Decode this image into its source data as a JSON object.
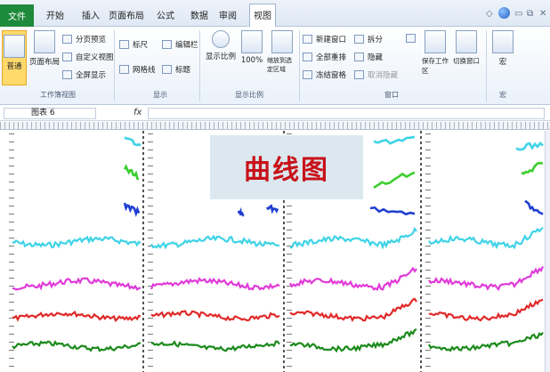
{
  "tabs": {
    "file": "文件",
    "items": [
      "开始",
      "插入",
      "页面布局",
      "公式",
      "数据",
      "审阅",
      "视图"
    ],
    "active_index": 6
  },
  "ribbon": {
    "workbook_views": {
      "label": "工作簿视图",
      "normal": "普通",
      "page_layout": "页面布局",
      "page_break": "分页预览",
      "custom": "自定义视图",
      "fullscreen": "全屏显示"
    },
    "show": {
      "label": "显示",
      "ruler": "标尺",
      "gridlines": "网格线",
      "formula_bar": "编辑栏",
      "headings": "标题"
    },
    "zoom": {
      "label": "显示比例",
      "zoom": "显示比例",
      "hundred": "100%",
      "selection": "缩放到选定区域"
    },
    "window": {
      "label": "窗口",
      "new_window": "新建窗口",
      "arrange_all": "全部重排",
      "freeze": "冻结窗格",
      "split": "拆分",
      "hide": "隐藏",
      "unhide": "取消隐藏",
      "save_workspace": "保存工作区",
      "switch_windows": "切换窗口"
    },
    "macros": {
      "label": "宏",
      "macros": "宏"
    }
  },
  "formula_bar": {
    "name_box": "图表 6",
    "fx": "fx",
    "value": ""
  },
  "content": {
    "title": "曲线图"
  },
  "colors": {
    "cyan": "#3fd3e6",
    "green": "#3ccf2e",
    "blue": "#1f3fd0",
    "magenta": "#e03ad8",
    "red": "#e02a2a",
    "dark_green": "#1c8a1c",
    "title_red": "#c8121a"
  }
}
